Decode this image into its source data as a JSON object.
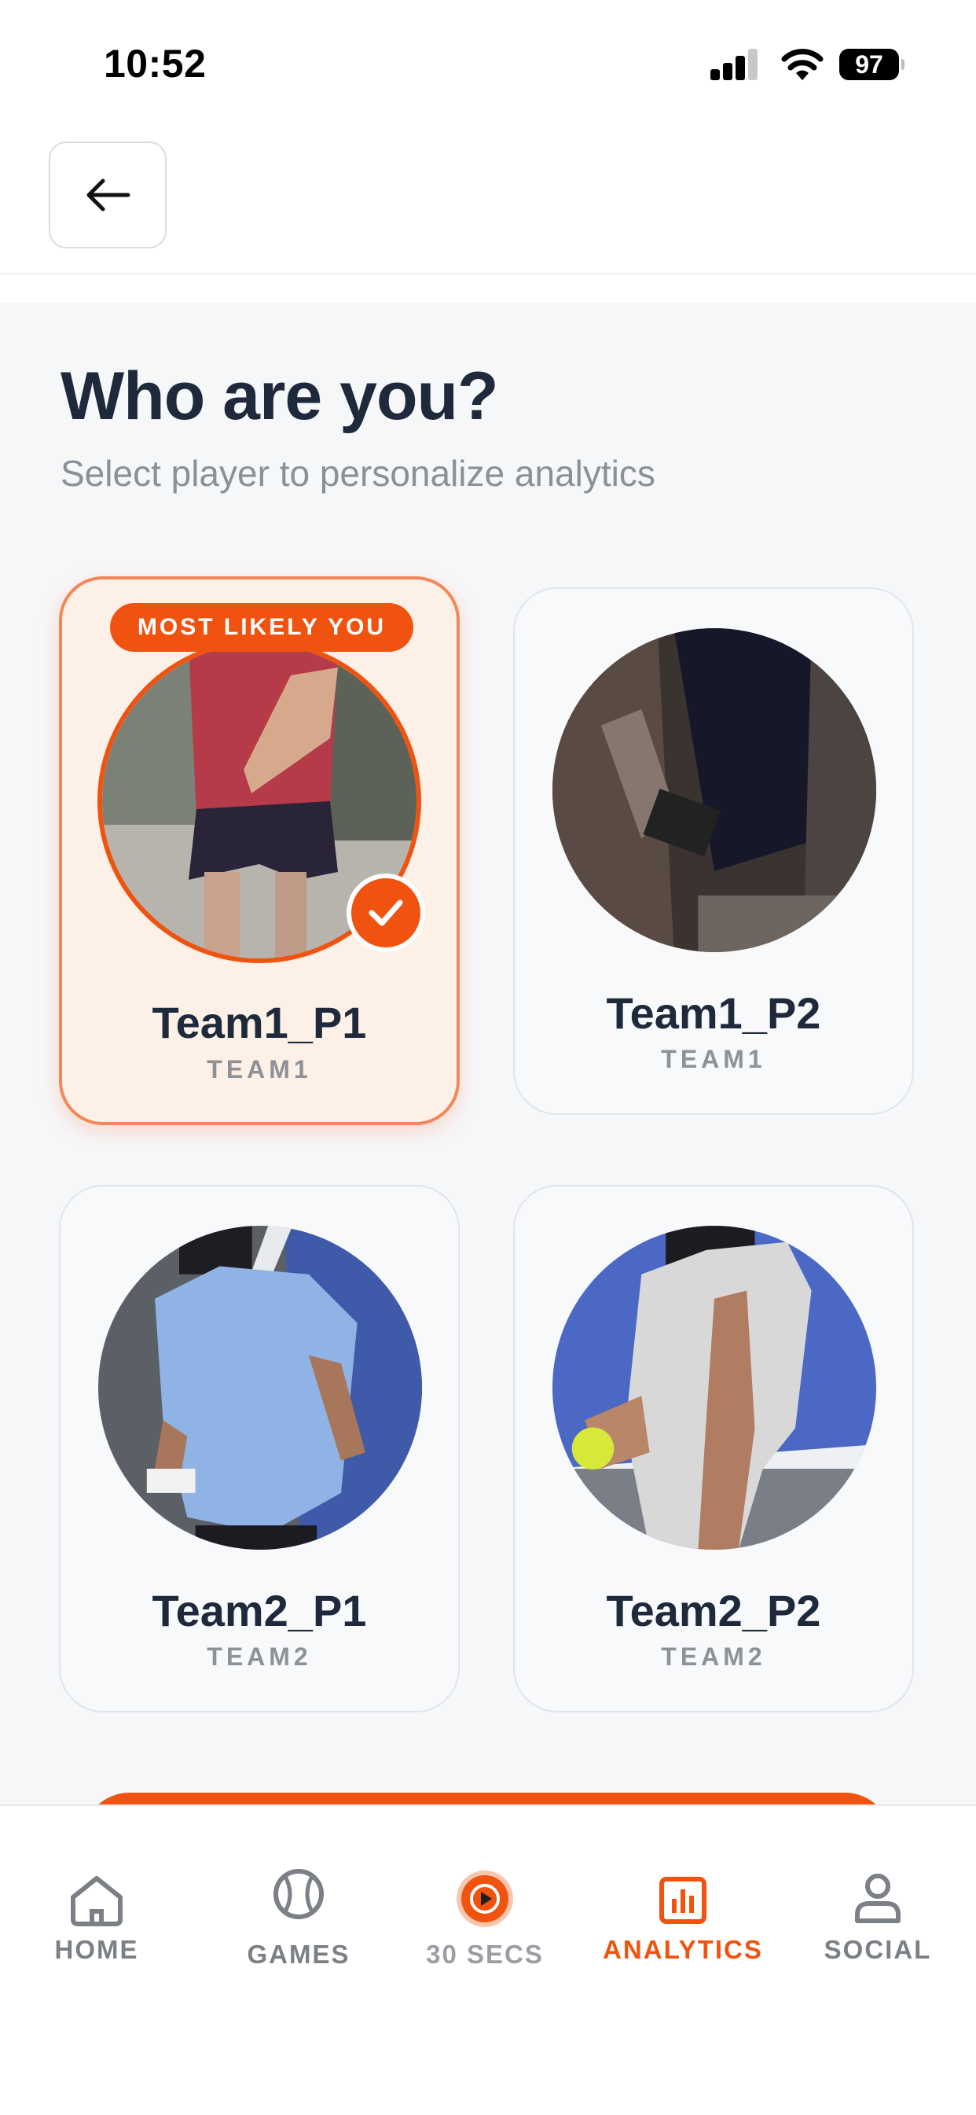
{
  "status_bar": {
    "time": "10:52",
    "battery_level": "97",
    "icons": [
      "signal-icon",
      "wifi-icon",
      "battery-icon"
    ]
  },
  "header": {
    "back_icon": "arrow-left-icon"
  },
  "main": {
    "title": "Who are you?",
    "subtitle": "Select player to personalize analytics",
    "players": [
      {
        "name": "Team1_P1",
        "team": "TEAM1",
        "selected": true,
        "badge": "MOST LIKELY YOU"
      },
      {
        "name": "Team1_P2",
        "team": "TEAM1",
        "selected": false
      },
      {
        "name": "Team2_P1",
        "team": "TEAM2",
        "selected": false
      },
      {
        "name": "Team2_P2",
        "team": "TEAM2",
        "selected": false
      }
    ]
  },
  "tab_bar": {
    "items": [
      {
        "label": "HOME",
        "icon": "home-icon"
      },
      {
        "label": "GAMES",
        "icon": "tennis-ball-icon"
      },
      {
        "label": "30 SECS",
        "icon": "play-circle-icon"
      },
      {
        "label": "ANALYTICS",
        "icon": "bar-chart-icon",
        "active": true
      },
      {
        "label": "SOCIAL",
        "icon": "person-icon"
      }
    ]
  },
  "colors": {
    "accent": "#f0530f",
    "title": "#1e293b",
    "muted": "#8a8f98",
    "content_background": "#f6f7f9"
  }
}
